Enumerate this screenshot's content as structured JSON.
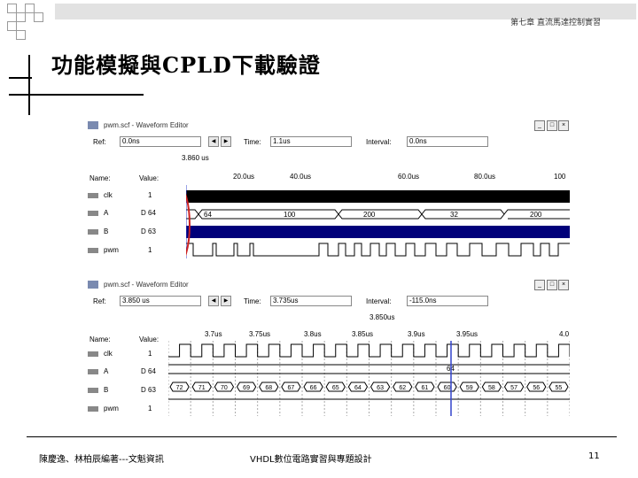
{
  "slide": {
    "chapter": "第七章  直流馬達控制實習",
    "title": "功能模擬與CPLD下載驗證",
    "footer_left": "陳慶逸、林柏辰編著---文魁資訊",
    "footer_center": "VHDL數位電路實習與專題設計",
    "page_number": "11"
  },
  "win1": {
    "title": "pwm.scf - Waveform Editor",
    "ref_label": "Ref:",
    "ref_value": "0.0ns",
    "time_label": "Time:",
    "time_value": "1.1us",
    "interval_label": "Interval:",
    "interval_value": "0.0ns",
    "cursor_value": "3.860 us",
    "name_header": "Name:",
    "value_header": "Value:",
    "time_ticks": [
      "20.0us",
      "40.0us",
      "60.0us",
      "80.0us",
      "100"
    ],
    "signals": [
      {
        "name": "clk",
        "value": "1"
      },
      {
        "name": "A",
        "value": "D 64"
      },
      {
        "name": "B",
        "value": "D 63"
      },
      {
        "name": "pwm",
        "value": "1"
      }
    ],
    "bus_a_labels": [
      "64",
      "100",
      "200",
      "32",
      "200"
    ]
  },
  "win2": {
    "title": "pwm.scf - Waveform Editor",
    "ref_label": "Ref:",
    "ref_value": "3.850 us",
    "time_label": "Time:",
    "time_value": "3.735us",
    "interval_label": "Interval:",
    "interval_value": "-115.0ns",
    "cursor_value": "3.850us",
    "name_header": "Name:",
    "value_header": "Value:",
    "time_ticks": [
      "3.7us",
      "3.75us",
      "3.8us",
      "3.85us",
      "3.9us",
      "3.95us",
      "4.0"
    ],
    "signals": [
      {
        "name": "clk",
        "value": "1"
      },
      {
        "name": "A",
        "value": "D 64"
      },
      {
        "name": "B",
        "value": "D 63"
      },
      {
        "name": "pwm",
        "value": "1"
      }
    ],
    "bus_a_label": "64",
    "bus_b_labels": [
      "72",
      "71",
      "70",
      "69",
      "68",
      "67",
      "66",
      "65",
      "64",
      "63",
      "62",
      "61",
      "60",
      "59",
      "58",
      "57",
      "56",
      "55"
    ]
  },
  "colors": {
    "bus_blue": "#00007a",
    "cursor_blue": "#3344cc",
    "highlight_red": "#cc2222"
  }
}
